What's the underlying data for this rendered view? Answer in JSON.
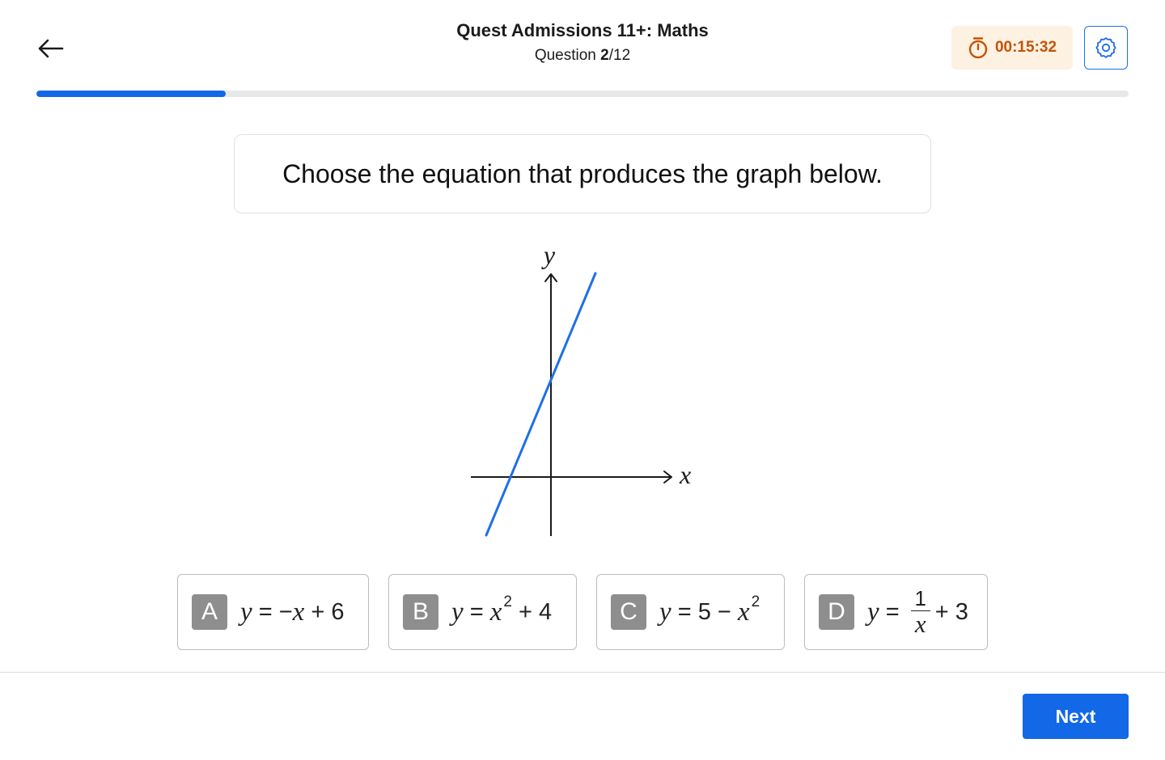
{
  "header": {
    "title": "Quest Admissions 11+: Maths",
    "question_prefix": "Question ",
    "question_current": "2",
    "question_sep_total": "/12",
    "back_icon": "arrow-left-icon",
    "timer_icon": "stopwatch-icon",
    "timer": "00:15:32",
    "settings_icon": "gear-icon"
  },
  "progress": {
    "fraction": 0.1736
  },
  "question": {
    "prompt": "Choose the equation that produces the graph below."
  },
  "graph": {
    "y_label": "y",
    "x_label": "x",
    "line_color": "#1f6fe8"
  },
  "choices": [
    {
      "letter": "A",
      "y": "y",
      "eq_sign": " = ",
      "minus": "−",
      "x": "x",
      "rest": " + 6"
    },
    {
      "letter": "B",
      "y": "y",
      "eq_sign": " = ",
      "x": "x",
      "exp": "2",
      "rest": " + 4"
    },
    {
      "letter": "C",
      "y": "y",
      "eq_sign": " = ",
      "lead": "5 − ",
      "x": "x",
      "exp": "2"
    },
    {
      "letter": "D",
      "y": "y",
      "eq_sign": " = ",
      "num": "1",
      "den": "x",
      "rest": "+ 3"
    }
  ],
  "footer": {
    "next_label": "Next"
  },
  "colors": {
    "accent": "#1368e8",
    "timer_bg": "#fdf1e2",
    "timer_text": "#c45206",
    "letter_badge": "#8e8e8e"
  }
}
